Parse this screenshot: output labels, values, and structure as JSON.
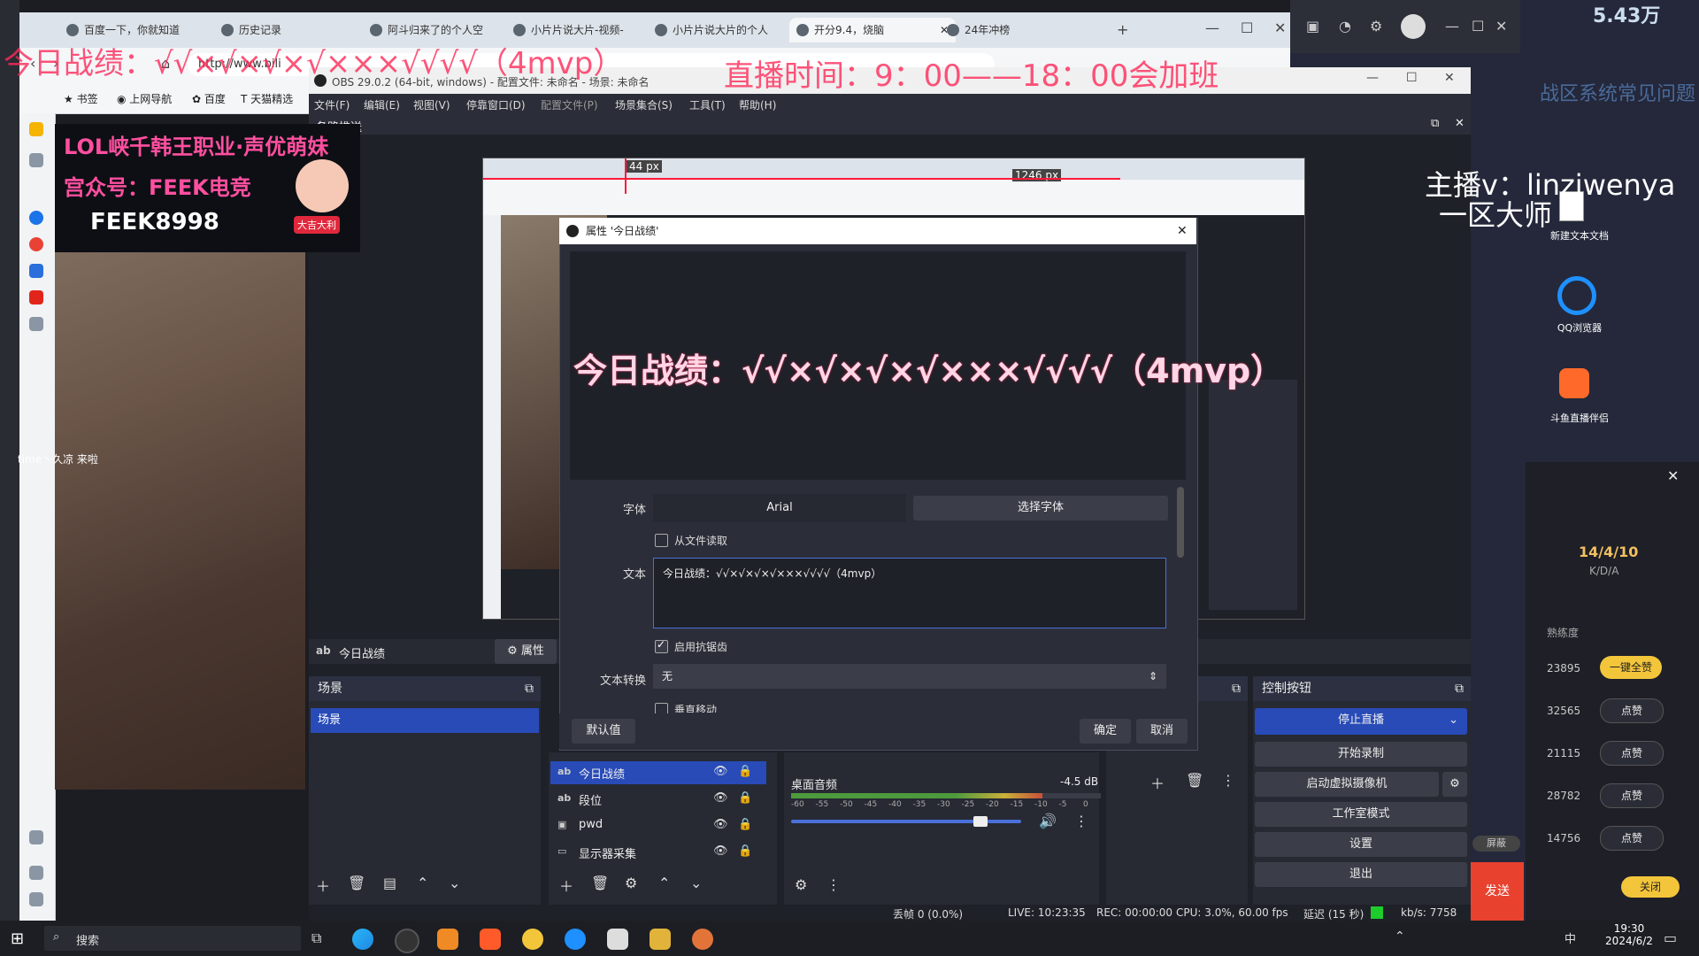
{
  "overlay": {
    "battle_record": "今日战绩：√√×√×√×√×××√√√√（4mvp）",
    "stream_time": "直播时间：9：00——18：00会加班",
    "anchor_line1": "主播v：linziwenya",
    "anchor_line2": "一区大师",
    "banner_line1": "LOL峡千韩王职业·声优萌妹",
    "banner_line2": "宫众号：FEEK电竞",
    "banner_line3": "FEEK8998",
    "badge": "大吉大利",
    "chat_msg": "time丶久凉 来啦",
    "top_right_amount": "5.43万"
  },
  "browser": {
    "tabs": [
      {
        "label": "百度一下，你就知道"
      },
      {
        "label": "历史记录"
      },
      {
        "label": "阿斗归来了的个人空"
      },
      {
        "label": "小片片说大片-视频-"
      },
      {
        "label": "小片片说大片的个人"
      },
      {
        "label": "开分9.4，烧脑"
      },
      {
        "label": "24年冲榜"
      }
    ],
    "url": "http://www.bili",
    "bookmarks": [
      "书签",
      "上网导航",
      "百度",
      "天猫精选"
    ]
  },
  "obs": {
    "title": "OBS 29.0.2 (64-bit, windows) - 配置文件: 未命名 - 场景: 未命名",
    "menu": [
      "文件(F)",
      "编辑(E)",
      "视图(V)",
      "停靠窗口(D)",
      "配置文件(P)",
      "场景集合(S)",
      "工具(T)",
      "帮助(H)"
    ],
    "section_label": "各路推送",
    "selected_source": "今日战绩",
    "properties_btn": "属性",
    "scenes_title": "场景",
    "scene_item": "场景",
    "sources": [
      {
        "label": "今日战绩",
        "type": "ab"
      },
      {
        "label": "段位",
        "type": "ab"
      },
      {
        "label": "pwd",
        "type": "img"
      },
      {
        "label": "显示器采集",
        "type": "mon"
      }
    ],
    "audio_label": "桌面音频",
    "audio_db": "-4.5 dB",
    "audio_ticks": [
      "-60",
      "-55",
      "-50",
      "-45",
      "-40",
      "-35",
      "-30",
      "-25",
      "-20",
      "-15",
      "-10",
      "-5",
      "0"
    ],
    "audio_level": 0.81,
    "controls_title": "控制按钮",
    "controls": [
      "停止直播",
      "开始录制",
      "启动虚拟摄像机",
      "工作室模式",
      "设置",
      "退出"
    ],
    "status": {
      "dropped": "丢帧 0 (0.0%)",
      "live": "LIVE: 10:23:35",
      "rec": "REC: 00:00:00",
      "cpu": "CPU: 3.0%, 60.00 fps",
      "latency": "延迟 (15 秒)",
      "kbs": "kb/s: 7758"
    },
    "canvas_px1": "44 px",
    "canvas_px2": "1246 px"
  },
  "dialog": {
    "title": "属性 '今日战绩'",
    "preview_text": "今日战绩：√√×√×√×√×××√√√√（4mvp）",
    "font_label": "字体",
    "font_value": "Arial",
    "choose_font": "选择字体",
    "from_file": "从文件读取",
    "text_label": "文本",
    "text_value": "今日战绩：√√×√×√×√×××√√√√（4mvp）",
    "antialias": "启用抗锯齿",
    "transform_label": "文本转换",
    "transform_value": "无",
    "vertical": "垂直移动",
    "defaults": "默认值",
    "ok": "确定",
    "cancel": "取消"
  },
  "right_panel": {
    "kda_score": "14/4/10",
    "kda_label": "K/D/A",
    "familiarity": "熟练度",
    "one_click_like": "一键全赞",
    "rows": [
      {
        "num": "23895"
      },
      {
        "num": "32565",
        "btn": "点赞"
      },
      {
        "num": "21115",
        "btn": "点赞"
      },
      {
        "num": "28782",
        "btn": "点赞"
      },
      {
        "num": "14756",
        "btn": "点赞"
      }
    ],
    "close_btn": "关闭",
    "send_btn": "发送",
    "mute_btn": "屏蔽",
    "desktop_icons": [
      "新建文本文档",
      "QQ浏览器",
      "斗鱼直播伴侣"
    ],
    "top_text": "战区系统常见问题"
  },
  "taskbar": {
    "search": "搜索",
    "time": "19:30",
    "date": "2024/6/2",
    "ime": "中"
  }
}
